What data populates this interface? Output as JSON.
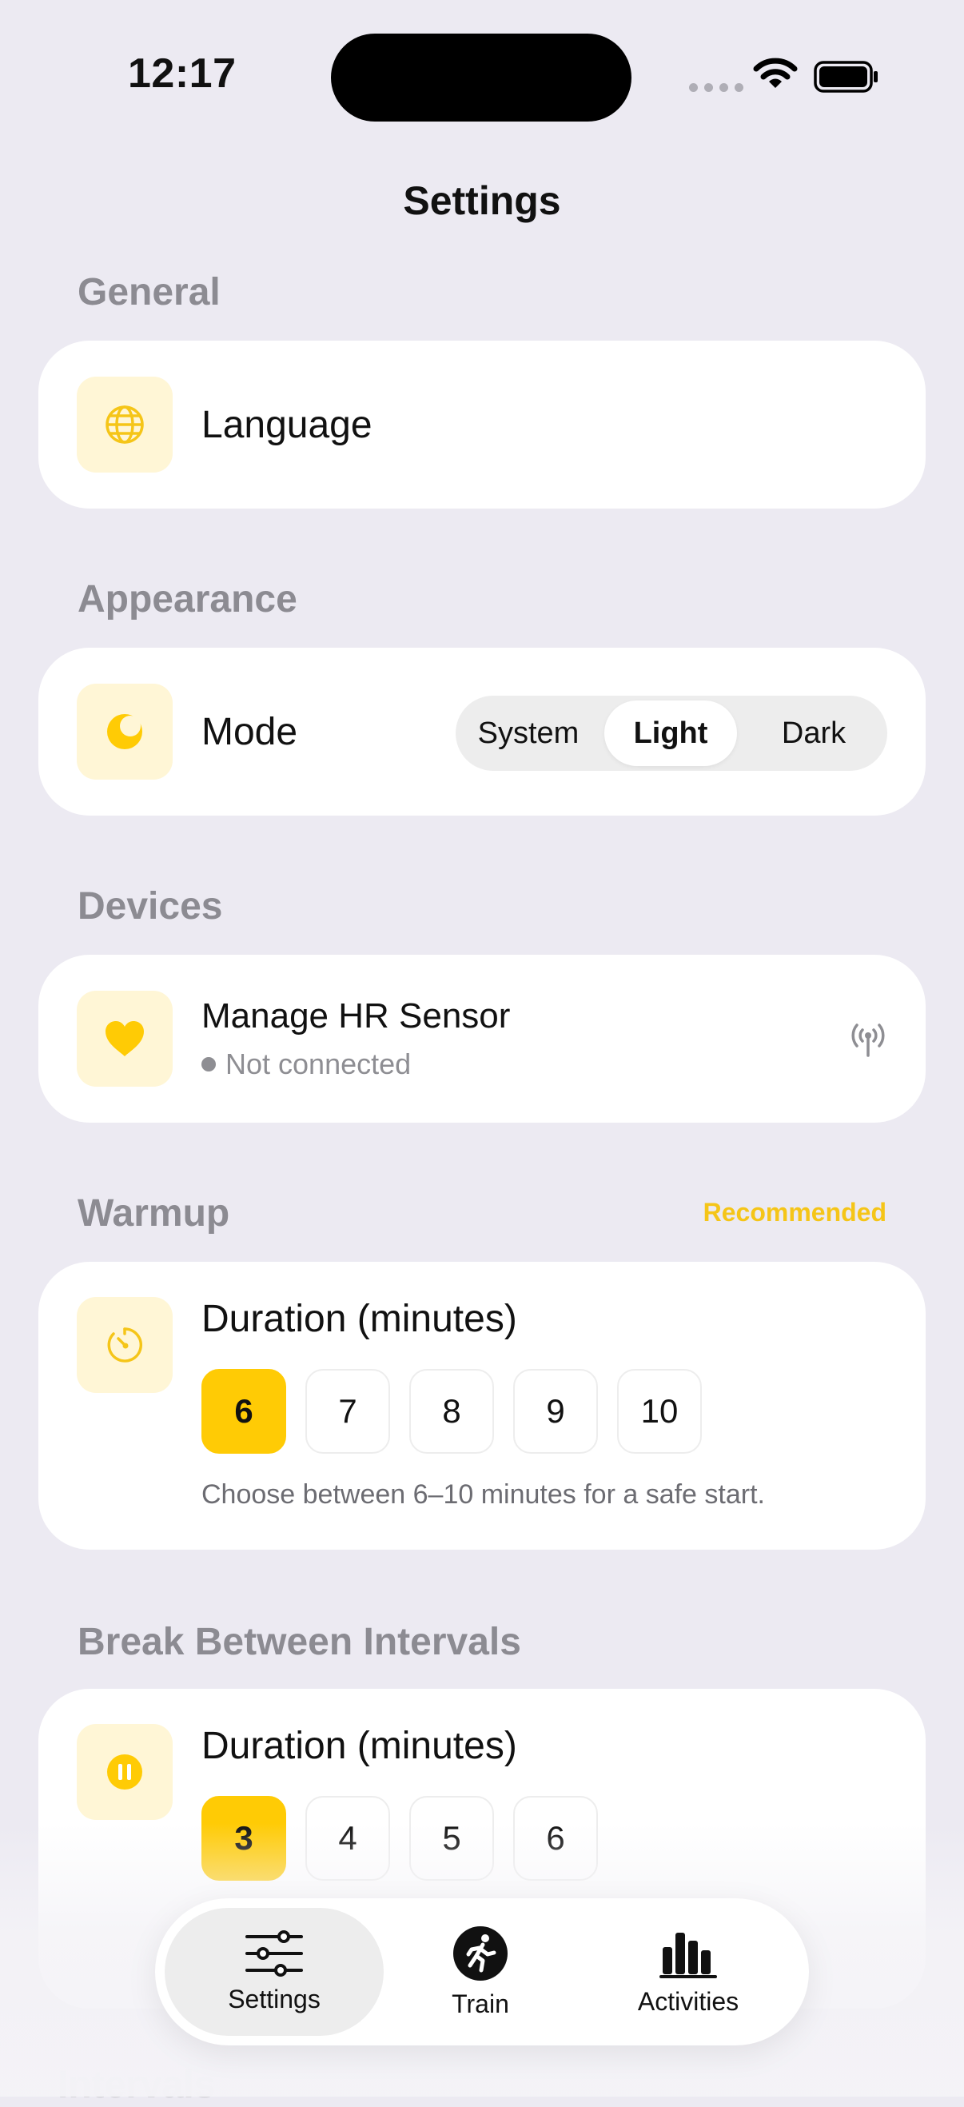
{
  "status_bar": {
    "time": "12:17"
  },
  "title": "Settings",
  "sections": {
    "general": {
      "label": "General",
      "language_label": "Language"
    },
    "appearance": {
      "label": "Appearance",
      "mode_label": "Mode",
      "options": [
        "System",
        "Light",
        "Dark"
      ],
      "selected": "Light"
    },
    "devices": {
      "label": "Devices",
      "hr_label": "Manage HR Sensor",
      "hr_status": "Not connected"
    },
    "warmup": {
      "label": "Warmup",
      "badge": "Recommended",
      "duration_label": "Duration (minutes)",
      "options": [
        "6",
        "7",
        "8",
        "9",
        "10"
      ],
      "selected": "6",
      "hint": "Choose between 6–10 minutes for a safe start."
    },
    "break": {
      "label": "Break Between Intervals",
      "duration_label": "Duration (minutes)",
      "options": [
        "3",
        "4",
        "5",
        "6"
      ],
      "selected": "3"
    },
    "next": {
      "label": "Intervals"
    }
  },
  "tabbar": {
    "tabs": [
      {
        "label": "Settings",
        "icon": "sliders-icon",
        "active": true
      },
      {
        "label": "Train",
        "icon": "runner-icon",
        "active": false
      },
      {
        "label": "Activities",
        "icon": "bar-chart-icon",
        "active": false
      }
    ]
  },
  "colors": {
    "accent": "#FFCB05",
    "tile_bg": "#FFF6D6",
    "background": "#ECEAF2"
  }
}
